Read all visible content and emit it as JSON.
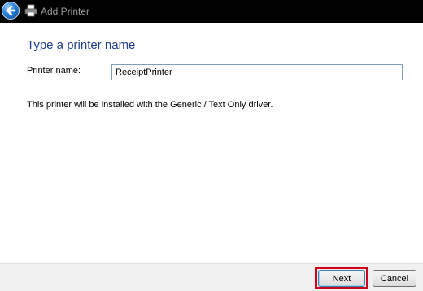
{
  "window": {
    "title": "Add Printer",
    "back_icon": "back-arrow-icon",
    "app_icon": "printer-icon"
  },
  "page": {
    "heading": "Type a printer name",
    "printer_name_label": "Printer name:",
    "printer_name_value": "ReceiptPrinter",
    "driver_message": "This printer will be installed with the Generic / Text Only driver."
  },
  "footer": {
    "next_label": "Next",
    "cancel_label": "Cancel"
  },
  "colors": {
    "heading": "#1f3e8a",
    "highlight": "#d0011b",
    "titlebar": "#000000"
  }
}
